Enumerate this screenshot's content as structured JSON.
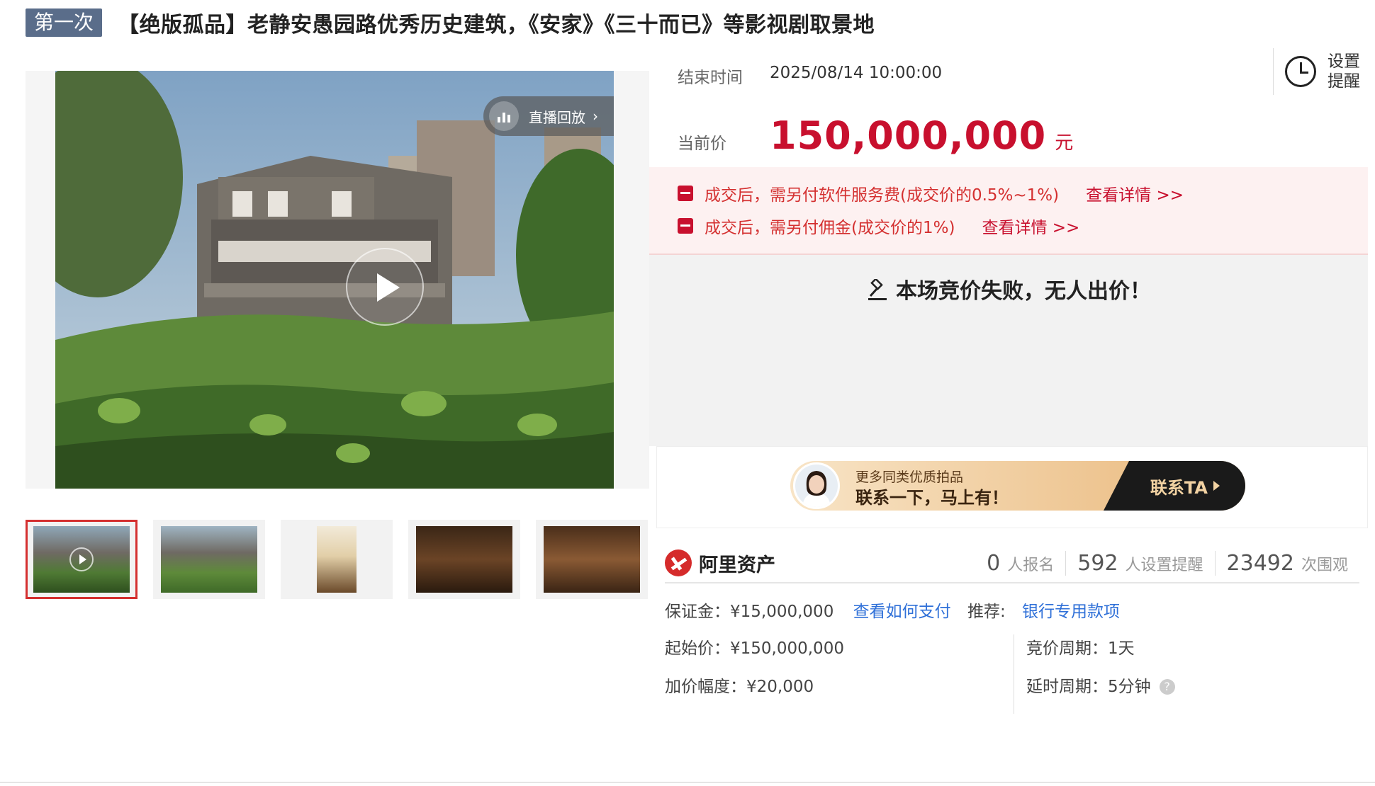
{
  "header": {
    "round_badge": "第一次",
    "title": "【绝版孤品】老静安愚园路优秀历史建筑，《安家》《三十而已》等影视剧取景地"
  },
  "gallery": {
    "replay_label": "直播回放",
    "thumbnail_count": 5,
    "active_thumbnail": 1
  },
  "auction": {
    "end_label": "结束时间",
    "end_time": "2025/08/14 10:00:00",
    "reminder_label_1": "设置",
    "reminder_label_2": "提醒",
    "current_price_label": "当前价",
    "current_price": "150,000,000",
    "price_unit": "元",
    "fees": [
      {
        "text": "成交后，需另付软件服务费(成交价的0.5%~1%)",
        "link": "查看详情 >>"
      },
      {
        "text": "成交后，需另付佣金(成交价的1%)",
        "link": "查看详情 >>"
      }
    ],
    "result_message": "本场竞价失败，无人出价！"
  },
  "ad": {
    "line1": "更多同类优质拍品",
    "line2": "联系一下，马上有！",
    "cta": "联系TA"
  },
  "platform": {
    "name": "阿里资产"
  },
  "stats": [
    {
      "value": "0",
      "label": "人报名"
    },
    {
      "value": "592",
      "label": "人设置提醒"
    },
    {
      "value": "23492",
      "label": "次围观"
    }
  ],
  "info": {
    "deposit": "保证金：¥15,000,000",
    "deposit_link": "查看如何支付",
    "recommend_label": "推荐:",
    "recommend_link": "银行专用款项",
    "start_price": "起始价：¥150,000,000",
    "bid_period": "竞价周期：1天",
    "increment": "加价幅度：¥20,000",
    "extend_period": "延时周期：5分钟",
    "help_glyph": "?"
  },
  "colors": {
    "price_red": "#c8102e",
    "fee_bg": "#fdf1f1",
    "link_blue": "#2f70d8",
    "badge_bg": "#5a6d8a"
  }
}
